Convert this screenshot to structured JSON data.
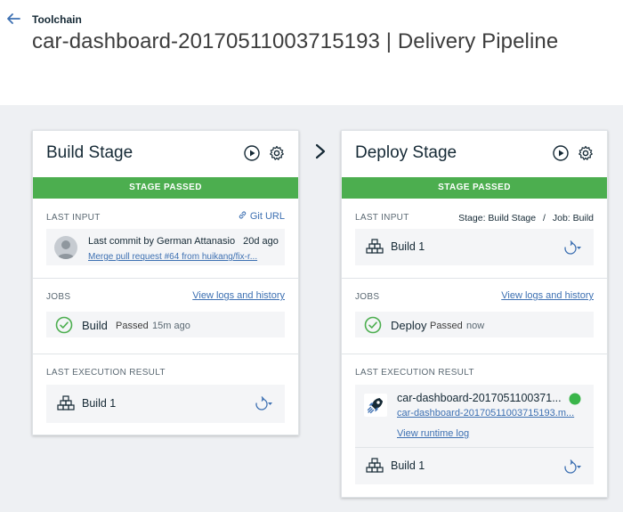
{
  "header": {
    "breadcrumb": "Toolchain",
    "title": "car-dashboard-20170511003715193 | Delivery Pipeline"
  },
  "build_stage": {
    "title": "Build Stage",
    "status_banner": "STAGE PASSED",
    "last_input_label": "LAST INPUT",
    "git_url_label": "Git URL",
    "commit_text": "Last commit by German Attanasio",
    "commit_age": "20d ago",
    "commit_link": "Merge pull request #64 from huikang/fix-r...",
    "jobs_label": "JOBS",
    "view_logs_label": "View logs and history",
    "job_name": "Build",
    "job_status": "Passed",
    "job_time": "15m ago",
    "last_execution_label": "LAST EXECUTION RESULT",
    "execution_build": "Build 1"
  },
  "deploy_stage": {
    "title": "Deploy Stage",
    "status_banner": "STAGE PASSED",
    "last_input_label": "LAST INPUT",
    "input_source": "Stage: Build Stage",
    "input_separator": "/",
    "input_job": "Job: Build",
    "input_build": "Build 1",
    "jobs_label": "JOBS",
    "view_logs_label": "View logs and history",
    "job_name": "Deploy",
    "job_status": "Passed",
    "job_time": "now",
    "last_execution_label": "LAST EXECUTION RESULT",
    "app_name": "car-dashboard-2017051100371...",
    "app_url": "car-dashboard-20170511003715193.m...",
    "runtime_log_label": "View runtime log",
    "execution_build": "Build 1"
  },
  "colors": {
    "passed_green": "#4cae4f",
    "link_blue": "#3d70b2",
    "canvas_bg": "#eef0f3",
    "tile_bg": "#f4f5f7",
    "running_dot": "#3ab54a"
  }
}
